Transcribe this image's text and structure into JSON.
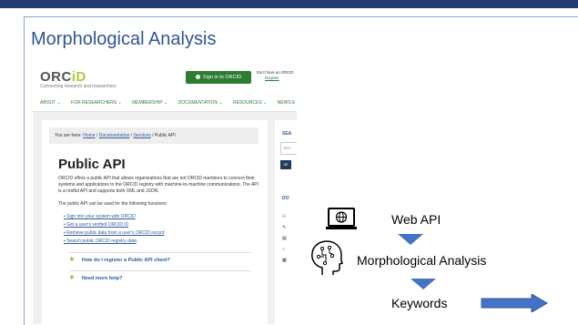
{
  "slide": {
    "title": "Morphological Analysis"
  },
  "orcid": {
    "logo_main": "ORC",
    "logo_id": "iD",
    "tagline": "Connecting research and researchers",
    "signin_label": "Sign in to ORCID",
    "no_account_line1": "Don't have an ORCID",
    "no_account_link": "Register",
    "nav_items": [
      "ABOUT ⌄",
      "FOR RESEARCHERS ⌄",
      "MEMBERSHIP ⌄",
      "DOCUMENTATION ⌄",
      "RESOURCES ⌄",
      "NEWS E"
    ],
    "breadcrumb_prefix": "You are here: ",
    "breadcrumb_home": "Home",
    "breadcrumb_sep1": " / ",
    "breadcrumb_docs": "Documentation",
    "breadcrumb_sep2": " / ",
    "breadcrumb_services": "Services",
    "breadcrumb_current": " / Public API",
    "page_heading": "Public API",
    "intro_text": "ORCID offers a public API that allows organizations that are not ORCID members to connect their systems and applications to the ORCID registry with machine-to-machine communications. The API is a restful API and supports both XML and JSON.",
    "functions_intro": "The public API can be used for the following functions:",
    "functions": [
      "Sign into your system with ORCID",
      "Get a user's verified ORCID iD",
      "Retrieve public data from a user's ORCID record",
      "Search public ORCID registry data"
    ],
    "accordion": [
      "How do I register a Public API client?",
      "Need more help?"
    ],
    "sidebar_search_title": "SEA",
    "sidebar_search_placeholder": "Sea",
    "sidebar_search_button": "SE",
    "sidebar_docs_title": "DO"
  },
  "diagram": {
    "web_api_label": "Web API",
    "morph_label": "Morphological Analysis",
    "keywords_label": "Keywords",
    "icons": [
      "globe-monitor-icon",
      "head-circuit-icon"
    ],
    "arrow_color": "#4472c4"
  }
}
